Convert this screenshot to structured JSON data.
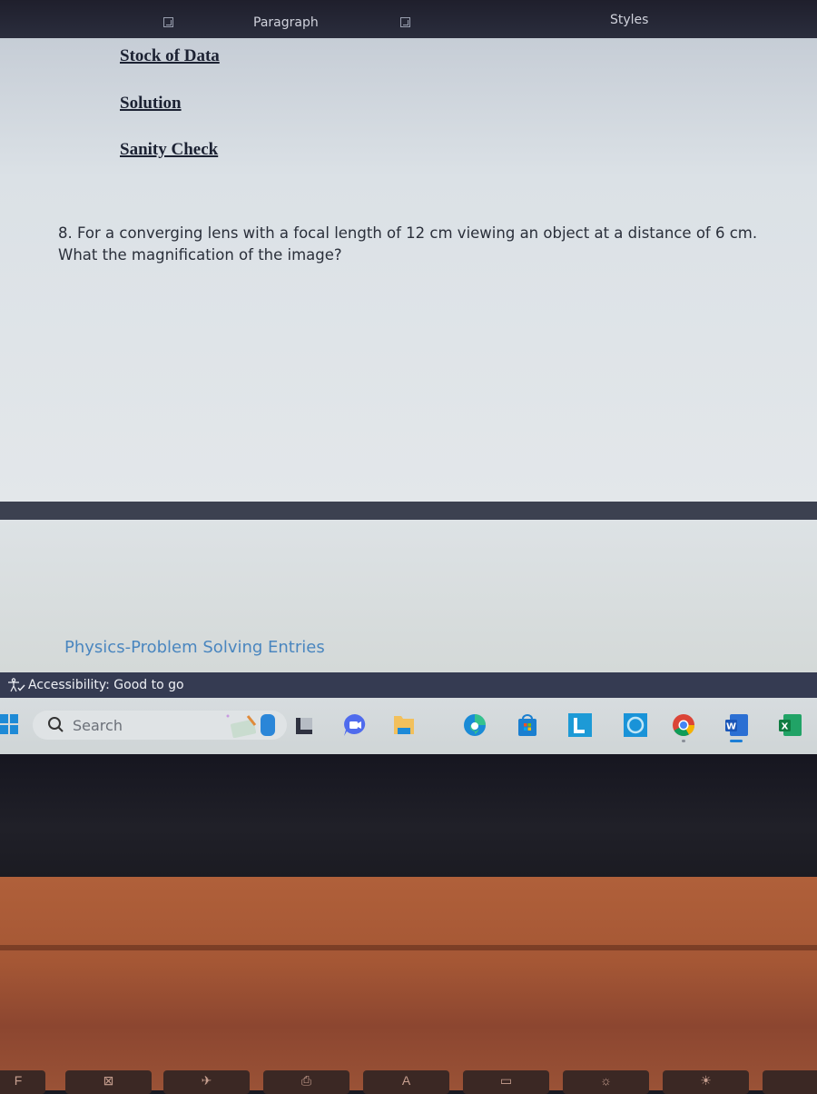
{
  "ribbon": {
    "groups": [
      {
        "label": "Paragraph"
      },
      {
        "label": "Styles"
      }
    ]
  },
  "document": {
    "headings": [
      "Stock of Data",
      "Solution",
      "Sanity Check"
    ],
    "question": "8. For a converging lens with a focal length of 12 cm viewing an object at a distance of 6 cm. What the magnification of the image?",
    "footer": "Physics-Problem Solving Entries"
  },
  "statusbar": {
    "accessibility": "Accessibility: Good to go"
  },
  "taskbar": {
    "search_placeholder": "Search",
    "apps": [
      "widgets",
      "task-view",
      "teams-chat",
      "file-explorer",
      "edge",
      "microsoft-store",
      "app-l",
      "app-cortana",
      "chrome",
      "word",
      "excel"
    ]
  },
  "keyboard": {
    "keys": [
      "F",
      "⊠",
      "✈",
      "⎙",
      "A",
      "▭",
      "☼",
      "☀"
    ]
  }
}
